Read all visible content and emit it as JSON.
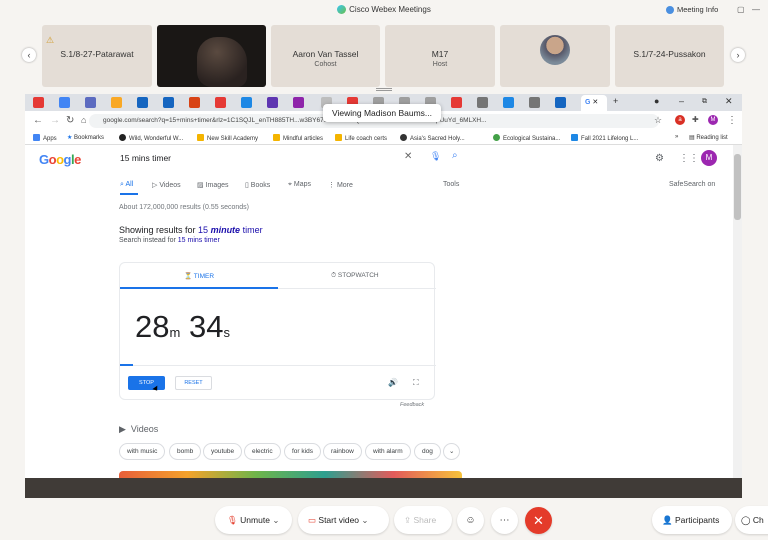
{
  "webex": {
    "title": "Cisco Webex Meetings",
    "meeting_info": "Meeting Info",
    "tiles": [
      {
        "name": "S.1/8-27-Patarawat",
        "role": ""
      },
      {
        "name": "",
        "role": ""
      },
      {
        "name": "Aaron Van Tassel",
        "role": "Cohost"
      },
      {
        "name": "M17",
        "role": "Host"
      },
      {
        "name": "",
        "role": ""
      },
      {
        "name": "S.1/7-24-Pussakon",
        "role": ""
      }
    ],
    "viewing_tooltip": "Viewing Madison Baums..."
  },
  "browser": {
    "active_tab_label": "G",
    "url": "google.com/search?q=15+mins+timer&rlz=1C1SQJL_enTH885TH...w3BY675Ua37bNuQ%3A1630463403813&ei=q-UuYd_6MLXH...",
    "bookmarks": [
      "Apps",
      "Bookmarks",
      "Wild, Wonderful W...",
      "New Skill Academy",
      "Mindful articles",
      "Life coach certs",
      "Asia's Sacred Holy...",
      "Ecological Sustaina...",
      "Fall 2021 Lifelong L..."
    ],
    "reading_list": "Reading list",
    "profile_initial": "M"
  },
  "google": {
    "logo": "Google",
    "query": "15 mins timer",
    "tabs": [
      "All",
      "Videos",
      "Images",
      "Books",
      "Maps",
      "More"
    ],
    "tools": "Tools",
    "safesearch": "SafeSearch on",
    "results_count": "About 172,000,000 results (0.55 seconds)",
    "showing_prefix": "Showing results for ",
    "showing_query_a": "15 ",
    "showing_query_b": "minute",
    "showing_query_c": " timer",
    "instead_prefix": "Search instead for ",
    "instead_link": "15 mins timer",
    "timer": {
      "tab_timer": "TIMER",
      "tab_stopwatch": "STOPWATCH",
      "minutes": "28",
      "min_unit": "m",
      "seconds": "34",
      "sec_unit": "s",
      "stop": "STOP",
      "reset": "RESET",
      "progress": 0.04
    },
    "feedback": "Feedback",
    "videos_heading": "Videos",
    "chips": [
      "with music",
      "bomb",
      "youtube",
      "electric",
      "for kids",
      "rainbow",
      "with alarm",
      "dog"
    ]
  },
  "toolbar": {
    "unmute": "Unmute",
    "start_video": "Start video",
    "share": "Share",
    "participants": "Participants",
    "chat": "Ch"
  }
}
